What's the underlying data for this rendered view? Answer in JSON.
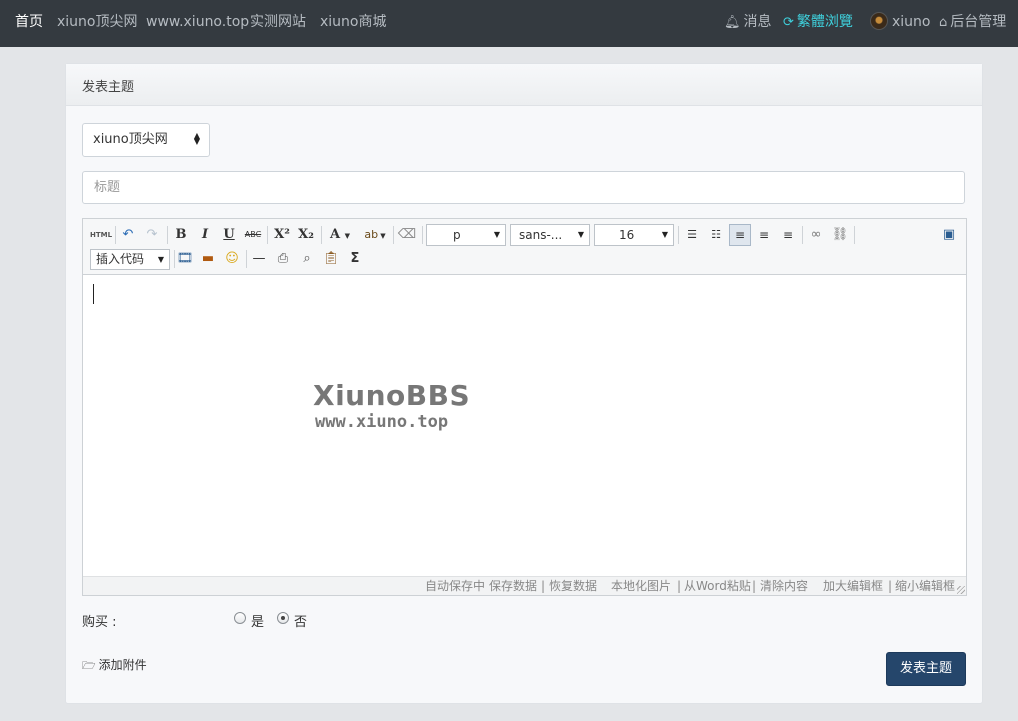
{
  "nav": {
    "home": "首页",
    "links": [
      "xiuno顶尖网",
      "www.xiuno.top",
      "实测网站",
      "xiuno商城"
    ],
    "messages": "消息",
    "traditional": "繁體浏覽",
    "username": "xiuno",
    "admin": "后台管理",
    "icons": {
      "messages": "bell-icon",
      "traditional": "refresh-icon",
      "admin": "home-icon"
    }
  },
  "page": {
    "title": "发表主题",
    "forum_select": "xiuno顶尖网",
    "subject_placeholder": "标题"
  },
  "editor": {
    "toolbar": {
      "html": "HTML",
      "paragraph": "p",
      "font_family": "sans-...",
      "font_size": "16",
      "insert_code": "插入代码"
    },
    "watermark": {
      "line1": "XiunoBBS",
      "line2": "www.xiuno.top"
    },
    "status": {
      "autosave": "自动保存中",
      "save": "保存数据",
      "restore": "恢复数据",
      "localize_images": "本地化图片",
      "paste_word": "从Word粘贴",
      "clear": "清除内容",
      "enlarge": "加大编辑框",
      "shrink": "缩小编辑框",
      "sep": "|"
    }
  },
  "purchase": {
    "label": "购买 :",
    "options": [
      "是",
      "否"
    ],
    "selected": "否"
  },
  "attach": {
    "label": "添加附件",
    "icon": "folder-open-icon"
  },
  "submit": {
    "label": "发表主题"
  },
  "colors": {
    "nav_bg": "#343a40",
    "accent_cyan": "#3fd0dc",
    "submit_bg": "#25466b",
    "page_bg": "#e3e5e8"
  }
}
